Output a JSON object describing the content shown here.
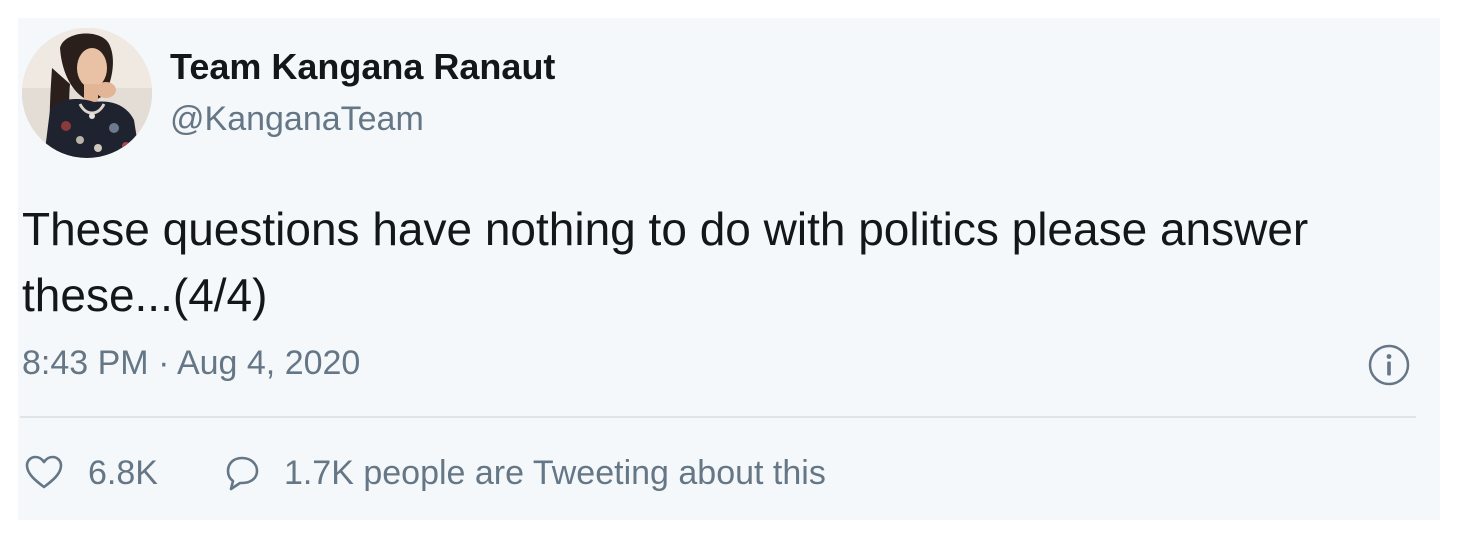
{
  "tweet": {
    "author": {
      "display_name": "Team Kangana Ranaut",
      "handle": "@KanganaTeam",
      "avatar_icon": "avatar-photo"
    },
    "text": "These questions have nothing to do with politics please answer these...(4/4)",
    "timestamp": "8:43 PM · Aug 4, 2020",
    "info_icon": "info-icon",
    "actions": {
      "like_icon": "heart-icon",
      "like_count": "6.8K",
      "reply_icon": "speech-bubble-icon",
      "reply_text": "1.7K people are Tweeting about this"
    }
  },
  "colors": {
    "card_background": "#f5f8fa",
    "primary_text": "#14171a",
    "secondary_text": "#657786",
    "divider": "#dfe4e8"
  }
}
